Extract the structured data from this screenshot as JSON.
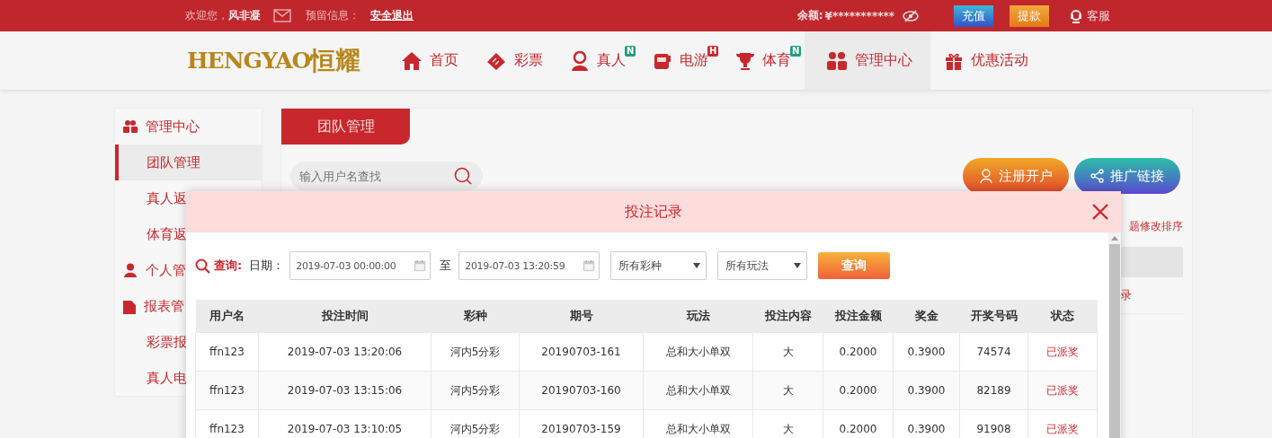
{
  "top_bar": {
    "welcome": "欢迎您，",
    "username": "风非凝",
    "reserved_label": "预留信息：",
    "logout": "安全退出",
    "balance_label": "余额:",
    "balance": "¥***********",
    "deposit": "充值",
    "withdraw": "提款",
    "support": "客服"
  },
  "logo": {
    "latin": "HENGYAO",
    "chinese": "恒耀"
  },
  "nav": [
    {
      "label": "首页",
      "kind": "home",
      "selected": false
    },
    {
      "label": "彩票",
      "kind": "ticket",
      "selected": false
    },
    {
      "label": "真人",
      "kind": "dealer",
      "selected": false,
      "badge": {
        "text": "N",
        "color": "#1f9e7e"
      }
    },
    {
      "label": "电游",
      "kind": "slot",
      "selected": false,
      "badge": {
        "text": "H",
        "color": "#d0262d"
      }
    },
    {
      "label": "体育",
      "kind": "trophy",
      "selected": false,
      "badge": {
        "text": "N",
        "color": "#1f9e7e"
      }
    },
    {
      "label": "管理中心",
      "kind": "people",
      "selected": true
    },
    {
      "label": "优惠活动",
      "kind": "gift",
      "selected": false
    }
  ],
  "sidebar": {
    "items": [
      {
        "label": "管理中心",
        "kind": "people",
        "children": [
          {
            "label": "团队管理",
            "selected": true
          },
          {
            "label": "真人返",
            "selected": false
          },
          {
            "label": "体育返",
            "selected": false
          }
        ]
      },
      {
        "label": "个人管",
        "kind": "person"
      },
      {
        "label": "报表管",
        "kind": "report",
        "children": [
          {
            "label": "彩票报",
            "selected": false
          },
          {
            "label": "真人电",
            "selected": false
          }
        ]
      }
    ]
  },
  "panel": {
    "tab": "团队管理",
    "search": {
      "placeholder": "输入用户名查找"
    },
    "register": "注册开户",
    "share": "推广链接",
    "hint": "题修改排序",
    "table_fragment": "录"
  },
  "modal": {
    "title": "投注记录",
    "query_label": "查询:",
    "date_label": "日期：",
    "date_from": "2019-07-03 00:00:00",
    "to": "至",
    "date_to": "2019-07-03 13:20:59",
    "lottery_select": "所有彩种",
    "play_select": "所有玩法",
    "query_button": "查询",
    "table": {
      "columns": [
        "用户名",
        "投注时间",
        "彩种",
        "期号",
        "玩法",
        "投注内容",
        "投注金额",
        "奖金",
        "开奖号码",
        "状态"
      ],
      "rows": [
        [
          "ffn123",
          "2019-07-03 13:20:06",
          "河内5分彩",
          "20190703-161",
          "总和大小单双",
          "大",
          "0.2000",
          "0.3900",
          "74574",
          "已派奖"
        ],
        [
          "ffn123",
          "2019-07-03 13:15:06",
          "河内5分彩",
          "20190703-160",
          "总和大小单双",
          "大",
          "0.2000",
          "0.3900",
          "82189",
          "已派奖"
        ],
        [
          "ffn123",
          "2019-07-03 13:10:05",
          "河内5分彩",
          "20190703-159",
          "总和大小单双",
          "大",
          "0.2000",
          "0.3900",
          "91908",
          "已派奖"
        ]
      ]
    }
  }
}
